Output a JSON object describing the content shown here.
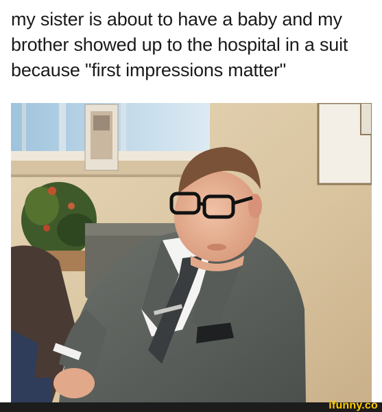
{
  "caption": {
    "line1": "my sister is about to have a baby and my",
    "line2": "brother showed up to the hospital in a suit",
    "line3": "because \"first impressions matter\""
  },
  "watermark": {
    "text": "ifunny.co"
  },
  "colors": {
    "wall": "#d8c39f",
    "suit": "#5d625e",
    "tie": "#3a3d3f",
    "watermark": "#ffcc00",
    "footer": "#1c1c1c"
  }
}
